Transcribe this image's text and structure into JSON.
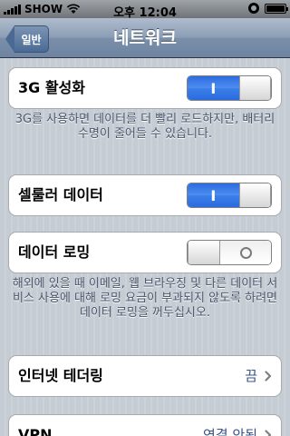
{
  "status_bar": {
    "carrier": "SHOW",
    "time": "오후 12:04",
    "battery_level": 1.0
  },
  "nav": {
    "back_label": "일반",
    "title": "네트워크"
  },
  "cells": {
    "enable_3g": {
      "label": "3G 활성화",
      "state": "on",
      "on_text": "I"
    },
    "cellular_data": {
      "label": "셀룰러 데이터",
      "state": "on",
      "on_text": "I"
    },
    "data_roaming": {
      "label": "데이터 로밍",
      "state": "off"
    },
    "internet_tethering": {
      "label": "인터넷 테더링",
      "value": "끔"
    },
    "vpn": {
      "label": "VPN",
      "value": "연결 안됨"
    }
  },
  "footers": {
    "enable_3g": "3G를 사용하면 데이터를 더 빨리 로드하지만, 배터리 수명이 줄어들 수 있습니다.",
    "data_roaming": "해외에 있을 때 이메일, 웹 브라우징 및 다른 데이터 서비스 사용에 대해 로밍 요금이 부과되지 않도록 하려면 데이터 로밍을 꺼두십시오."
  },
  "icons": {
    "back": "back-arrow-icon",
    "chevron": "chevron-right-icon",
    "wifi": "wifi-icon",
    "battery": "battery-icon"
  },
  "colors": {
    "switch_on": "#3b7fe8",
    "value_text": "#385487",
    "footer_text": "#4c566c"
  }
}
